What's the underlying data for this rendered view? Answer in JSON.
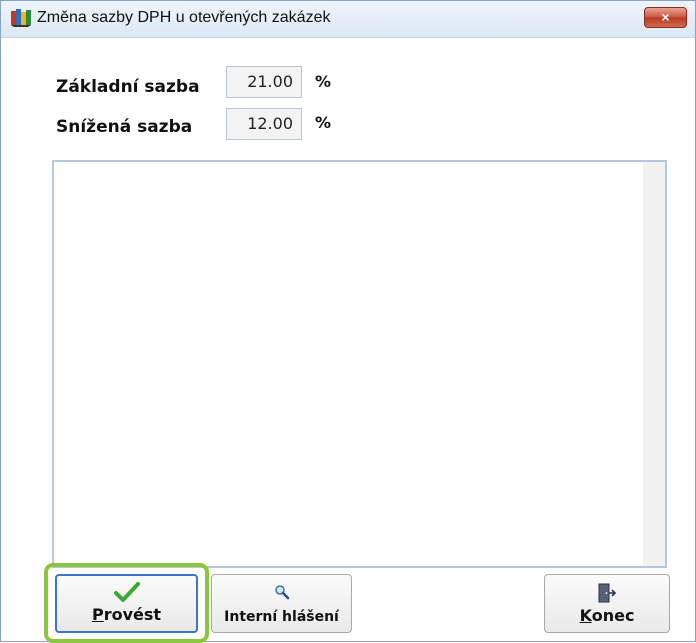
{
  "window": {
    "title": "Změna sazby DPH u otevřených zakázek",
    "close_label": "×"
  },
  "rates": {
    "basic": {
      "label": "Základní sazba",
      "value": "21.00",
      "unit": "%"
    },
    "reduced": {
      "label": "Snížená sazba",
      "value": "12.00",
      "unit": "%"
    }
  },
  "log": {
    "content": ""
  },
  "buttons": {
    "execute": {
      "label": "Provést",
      "icon": "checkmark-icon"
    },
    "internal_report": {
      "label": "Interní hlášení",
      "icon": "magnifier-icon"
    },
    "exit": {
      "label": "Konec",
      "icon": "exit-door-icon"
    }
  },
  "colors": {
    "focus_ring": "#8cc63f",
    "close_button": "#c9543c",
    "check": "#3aa935"
  }
}
